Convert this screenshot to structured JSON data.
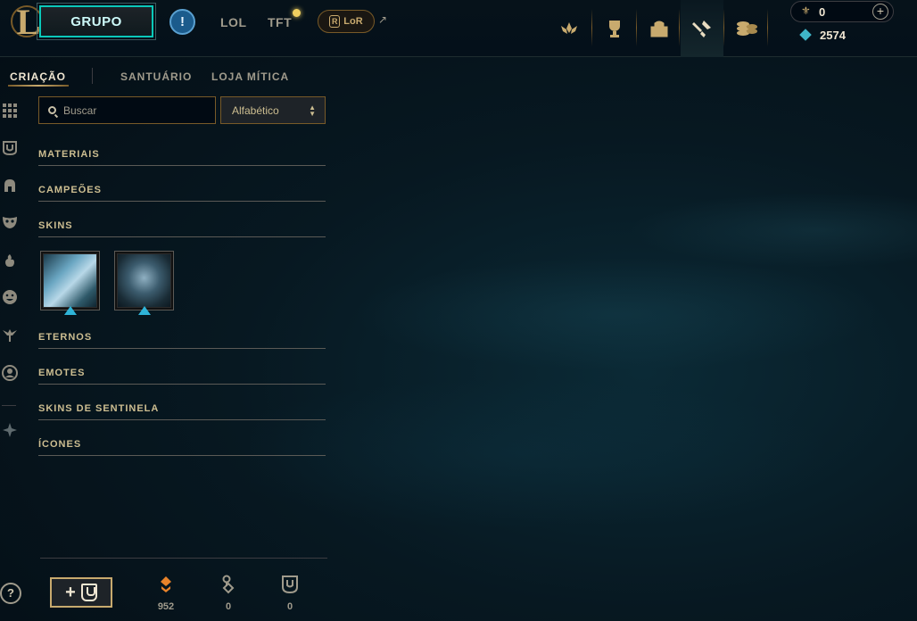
{
  "topbar": {
    "play_label": "GRUPO",
    "alert_glyph": "!",
    "game_tabs": [
      "LOL",
      "TFT"
    ],
    "lor_label": "LoR",
    "lor_badge": "R",
    "rp": "0",
    "blue_essence": "2574",
    "plus_glyph": "+",
    "nav_icons": [
      "lotus-icon",
      "trophy-icon",
      "collection-icon",
      "loot-icon",
      "store-icon"
    ]
  },
  "subtabs": [
    "CRIAÇÃO",
    "SANTUÁRIO",
    "LOJA MÍTICA"
  ],
  "search": {
    "placeholder": "Buscar"
  },
  "sort": {
    "value": "Alfabético"
  },
  "categories": [
    "MATERIAIS",
    "CAMPEÕES",
    "SKINS",
    "ETERNOS",
    "EMOTES",
    "SKINS DE SENTINELA",
    "ÍCONES"
  ],
  "rail_icons": [
    "grid-icon",
    "chest-icon",
    "helmet-icon",
    "mask-icon",
    "flame-icon",
    "emote-icon",
    "ward-icon",
    "profile-icon",
    "crest-icon"
  ],
  "bottom": {
    "help_glyph": "?",
    "add_glyph": "+",
    "orange_essence": "952",
    "keys": "0",
    "chests": "0"
  },
  "colors": {
    "gold": "#c8aa6e",
    "teal": "#0ac8b9",
    "background": "#071821"
  }
}
